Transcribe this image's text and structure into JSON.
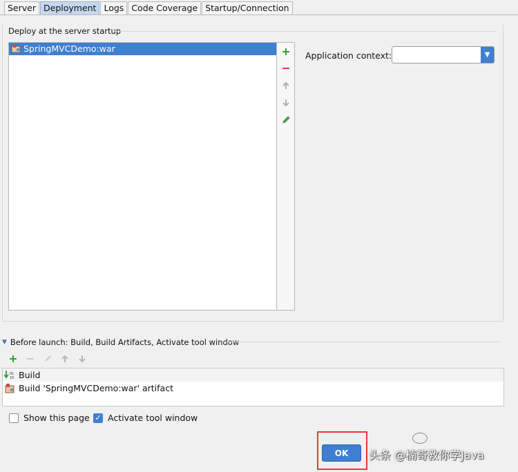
{
  "tabs": [
    {
      "label": "Server",
      "active": false
    },
    {
      "label": "Deployment",
      "active": true
    },
    {
      "label": "Logs",
      "active": false
    },
    {
      "label": "Code Coverage",
      "active": false
    },
    {
      "label": "Startup/Connection",
      "active": false
    }
  ],
  "deploy": {
    "section_title": "Deploy at the server startup",
    "items": [
      "SpringMVCDemo:war"
    ],
    "toolbar_icons": [
      "add-icon",
      "remove-icon",
      "move-up-icon",
      "move-down-icon",
      "edit-icon"
    ]
  },
  "application_context": {
    "label": "Application context:",
    "value": ""
  },
  "before_launch": {
    "title": "Before launch: Build, Build Artifacts, Activate tool window",
    "items": [
      "Build",
      "Build 'SpringMVCDemo:war' artifact"
    ]
  },
  "options": {
    "show_this_page": {
      "label": "Show this page",
      "checked": false
    },
    "activate_tool_window": {
      "label": "Activate tool window",
      "checked": true
    }
  },
  "ok_button": {
    "label": "OK"
  },
  "watermark": {
    "text": "头条 @楠哥教你学Java"
  },
  "colors": {
    "accent": "#3f7fd1",
    "highlight": "#e23a3a",
    "add": "#2ea12e",
    "remove": "#d9403a"
  }
}
